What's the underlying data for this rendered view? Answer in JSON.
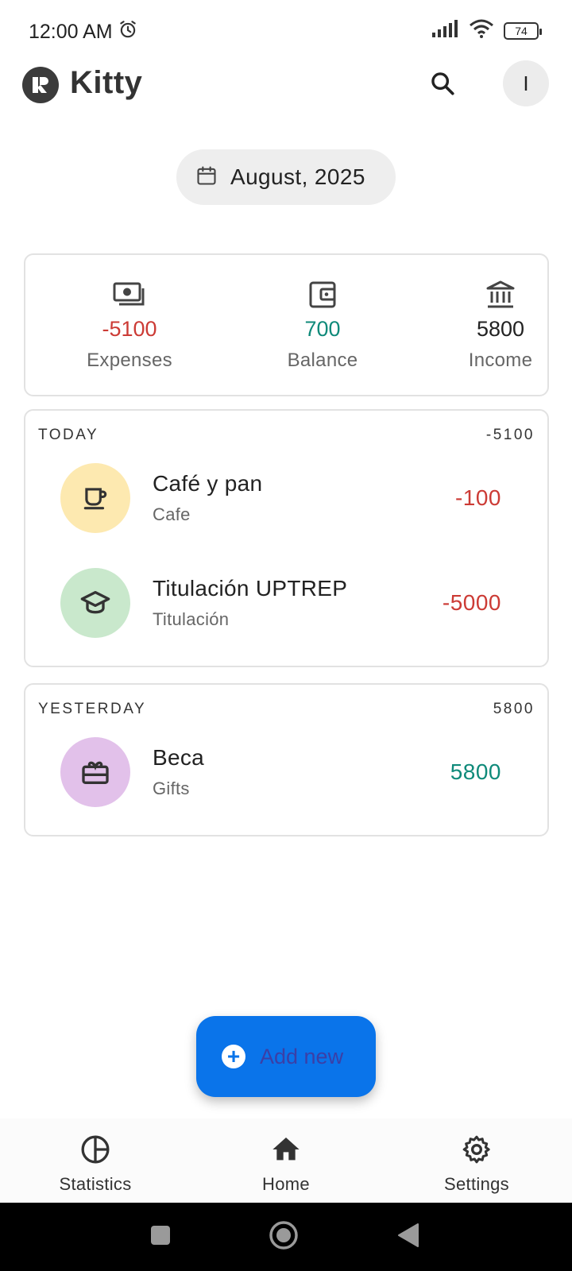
{
  "status_bar": {
    "time": "12:00 AM",
    "battery": "74"
  },
  "app": {
    "title": "Kitty",
    "avatar_initial": "I"
  },
  "month": {
    "label": "August, 2025"
  },
  "summary": {
    "expenses": {
      "value": "-5100",
      "label": "Expenses"
    },
    "balance": {
      "value": "700",
      "label": "Balance"
    },
    "income": {
      "value": "5800",
      "label": "Income"
    }
  },
  "groups": [
    {
      "title": "TODAY",
      "total": "-5100",
      "items": [
        {
          "name": "Café y pan",
          "category": "Cafe",
          "amount": "-100",
          "icon": "coffee-cup-icon",
          "color": "#fde9b0"
        },
        {
          "name": "Titulación UPTREP",
          "category": "Titulación",
          "amount": "-5000",
          "icon": "graduation-cap-icon",
          "color": "#c9e8cc"
        }
      ]
    },
    {
      "title": "YESTERDAY",
      "total": "5800",
      "items": [
        {
          "name": "Beca",
          "category": "Gifts",
          "amount": "5800",
          "icon": "gift-card-icon",
          "color": "#e2c1ea"
        }
      ]
    }
  ],
  "fab": {
    "label": "Add new"
  },
  "bottom_nav": {
    "statistics": "Statistics",
    "home": "Home",
    "settings": "Settings"
  },
  "colors": {
    "expense": "#cc3b35",
    "income": "#0f8a7a",
    "accent": "#0a74ea"
  }
}
